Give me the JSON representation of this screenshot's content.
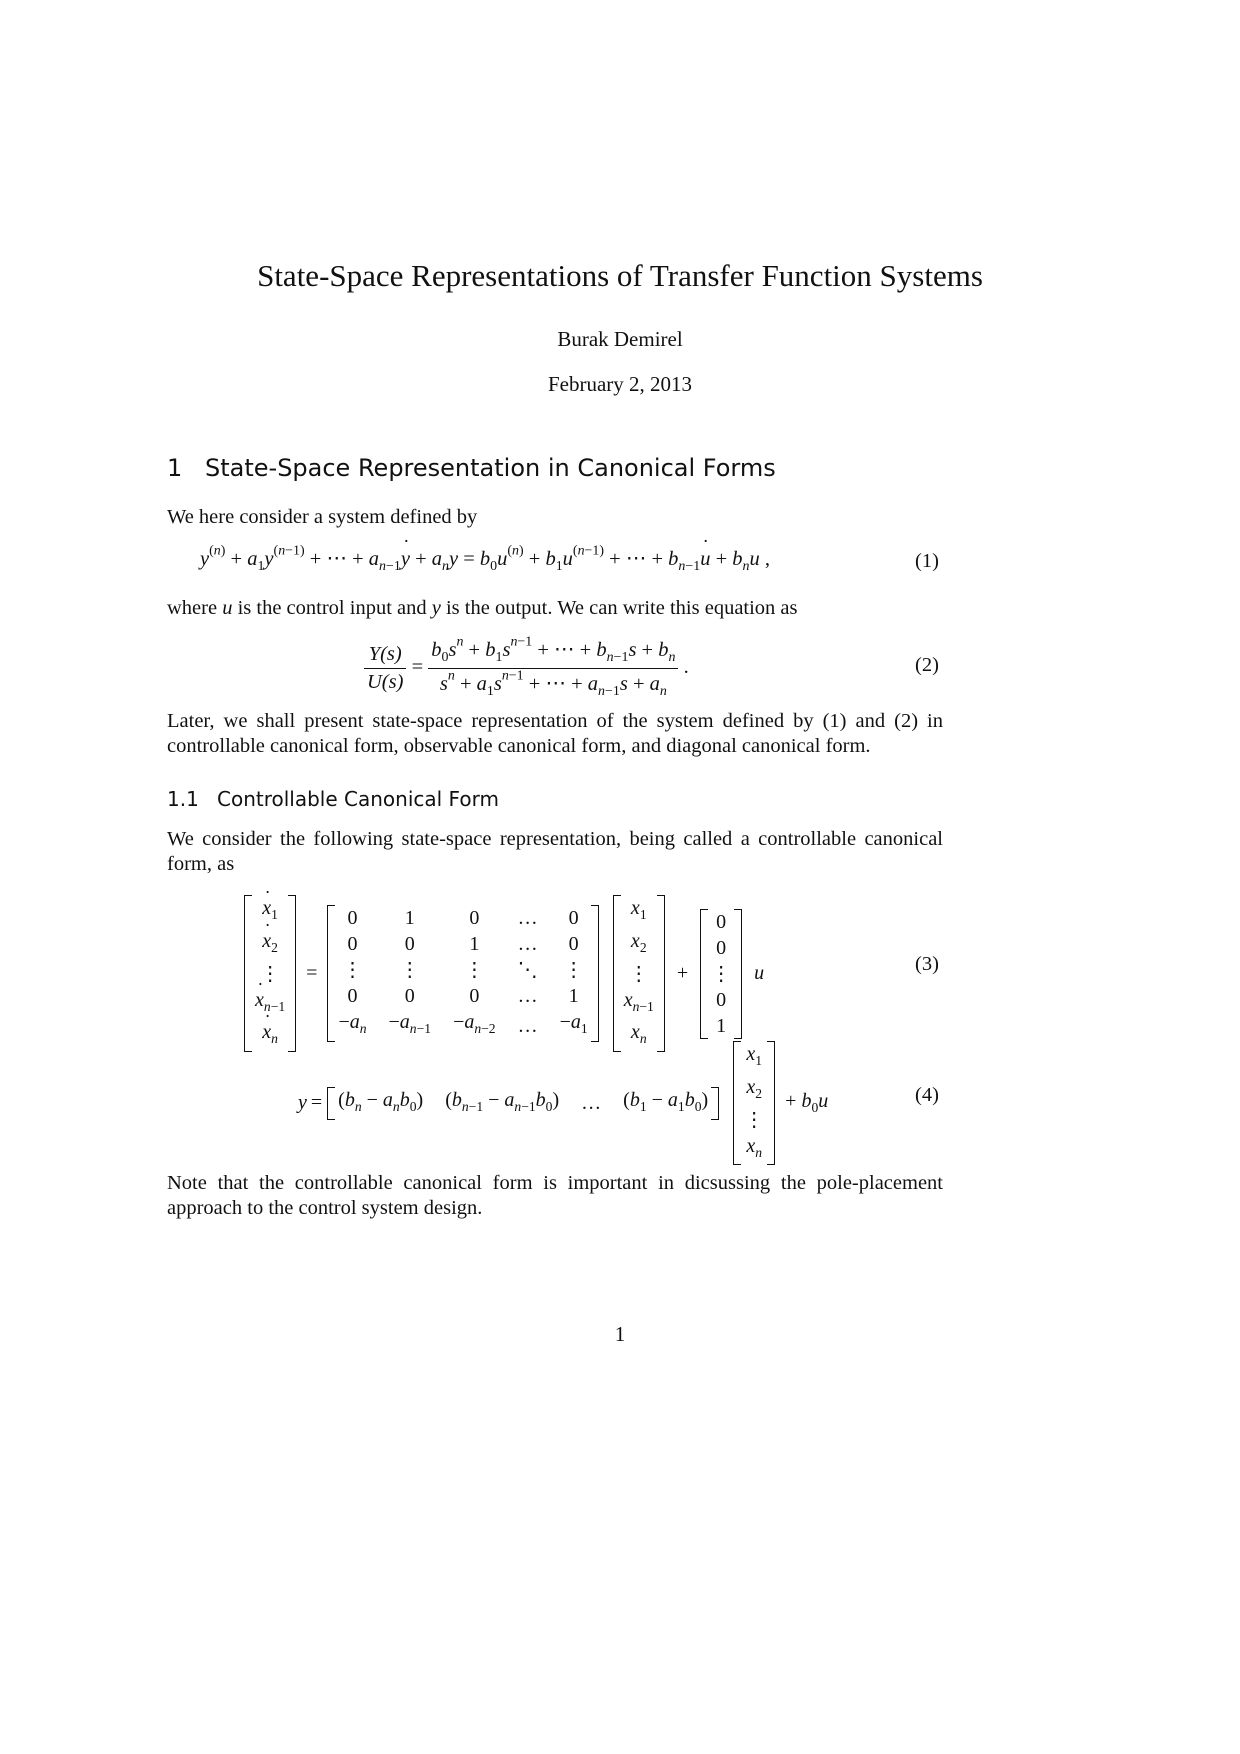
{
  "document": {
    "title": "State-Space Representations of Transfer Function Systems",
    "author": "Burak Demirel",
    "date": "February 2, 2013",
    "page_number": "1"
  },
  "section1": {
    "number": "1",
    "title": "State-Space Representation in Canonical Forms",
    "intro": "We here consider a system defined by",
    "after_eq1_a": "where ",
    "after_eq1_u": "u",
    "after_eq1_b": " is the control input and ",
    "after_eq1_y": "y",
    "after_eq1_c": " is the output. We can write this equation as",
    "after_eq2": "Later, we shall present state-space representation of the system defined by (1) and (2) in controllable canonical form, observable canonical form, and diagonal canonical form."
  },
  "equations": {
    "eq1_number": "(1)",
    "eq2_number": "(2)",
    "eq3_number": "(3)",
    "eq4_number": "(4)",
    "eq2_lhs_num": "Y(s)",
    "eq2_lhs_den": "U(s)",
    "eq3": {
      "xdot": [
        "x1",
        "x2",
        "⋮",
        "xn−1",
        "xn"
      ],
      "A": [
        [
          "0",
          "1",
          "0",
          "…",
          "0"
        ],
        [
          "0",
          "0",
          "1",
          "…",
          "0"
        ],
        [
          "⋮",
          "⋮",
          "⋮",
          "⋱",
          "⋮"
        ],
        [
          "0",
          "0",
          "0",
          "…",
          "1"
        ],
        [
          "−an",
          "−an−1",
          "−an−2",
          "…",
          "−a1"
        ]
      ],
      "x": [
        "x1",
        "x2",
        "⋮",
        "xn−1",
        "xn"
      ],
      "B": [
        "0",
        "0",
        "⋮",
        "0",
        "1"
      ],
      "input": "u"
    },
    "eq4": {
      "C": [
        "(bn − anb0)",
        "(bn−1 − an−1b0)",
        "…",
        "(b1 − a1b0)"
      ],
      "x": [
        "x1",
        "x2",
        "⋮",
        "xn"
      ],
      "feedthrough": "+ b0u"
    }
  },
  "subsection11": {
    "number": "1.1",
    "title": "Controllable Canonical Form",
    "intro": "We consider the following state-space representation, being called a controllable canonical form, as",
    "note": "Note that the controllable canonical form is important in dicsussing the pole-placement approach to the control system design."
  }
}
